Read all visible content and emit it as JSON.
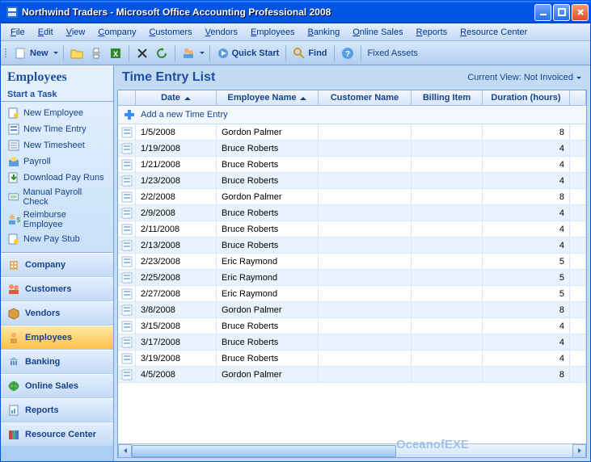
{
  "window": {
    "title": "Northwind Traders - Microsoft Office Accounting Professional 2008"
  },
  "menu": [
    "File",
    "Edit",
    "View",
    "Company",
    "Customers",
    "Vendors",
    "Employees",
    "Banking",
    "Online Sales",
    "Reports",
    "Resource Center"
  ],
  "toolbar": {
    "new_label": "New",
    "quickstart_label": "Quick Start",
    "find_label": "Find",
    "fixedassets_label": "Fixed Assets"
  },
  "sidebar": {
    "title": "Employees",
    "subtitle": "Start a Task",
    "tasks": [
      {
        "label": "New Employee"
      },
      {
        "label": "New Time Entry"
      },
      {
        "label": "New Timesheet"
      },
      {
        "label": "Payroll"
      },
      {
        "label": "Download Pay Runs"
      },
      {
        "label": "Manual Payroll Check"
      },
      {
        "label": "Reimburse Employee"
      },
      {
        "label": "New Pay Stub"
      }
    ],
    "nav": [
      {
        "label": "Company",
        "icon": "building"
      },
      {
        "label": "Customers",
        "icon": "people"
      },
      {
        "label": "Vendors",
        "icon": "box"
      },
      {
        "label": "Employees",
        "icon": "person",
        "active": true
      },
      {
        "label": "Banking",
        "icon": "bank"
      },
      {
        "label": "Online Sales",
        "icon": "globe"
      },
      {
        "label": "Reports",
        "icon": "report"
      },
      {
        "label": "Resource Center",
        "icon": "books"
      }
    ]
  },
  "main": {
    "title": "Time Entry List",
    "view_label": "Current View: Not Invoiced",
    "add_label": "Add a new Time Entry",
    "columns": {
      "date": "Date",
      "employee": "Employee Name",
      "customer": "Customer Name",
      "billing": "Billing Item",
      "duration": "Duration (hours)"
    },
    "rows": [
      {
        "date": "1/5/2008",
        "emp": "Gordon Palmer",
        "dur": "8"
      },
      {
        "date": "1/19/2008",
        "emp": "Bruce Roberts",
        "dur": "4"
      },
      {
        "date": "1/21/2008",
        "emp": "Bruce Roberts",
        "dur": "4"
      },
      {
        "date": "1/23/2008",
        "emp": "Bruce Roberts",
        "dur": "4"
      },
      {
        "date": "2/2/2008",
        "emp": "Gordon Palmer",
        "dur": "8"
      },
      {
        "date": "2/9/2008",
        "emp": "Bruce Roberts",
        "dur": "4"
      },
      {
        "date": "2/11/2008",
        "emp": "Bruce Roberts",
        "dur": "4"
      },
      {
        "date": "2/13/2008",
        "emp": "Bruce Roberts",
        "dur": "4"
      },
      {
        "date": "2/23/2008",
        "emp": "Eric Raymond",
        "dur": "5"
      },
      {
        "date": "2/25/2008",
        "emp": "Eric Raymond",
        "dur": "5"
      },
      {
        "date": "2/27/2008",
        "emp": "Eric Raymond",
        "dur": "5"
      },
      {
        "date": "3/8/2008",
        "emp": "Gordon Palmer",
        "dur": "8"
      },
      {
        "date": "3/15/2008",
        "emp": "Bruce Roberts",
        "dur": "4"
      },
      {
        "date": "3/17/2008",
        "emp": "Bruce Roberts",
        "dur": "4"
      },
      {
        "date": "3/19/2008",
        "emp": "Bruce Roberts",
        "dur": "4"
      },
      {
        "date": "4/5/2008",
        "emp": "Gordon Palmer",
        "dur": "8"
      }
    ],
    "watermark": "OceanofEXE"
  }
}
